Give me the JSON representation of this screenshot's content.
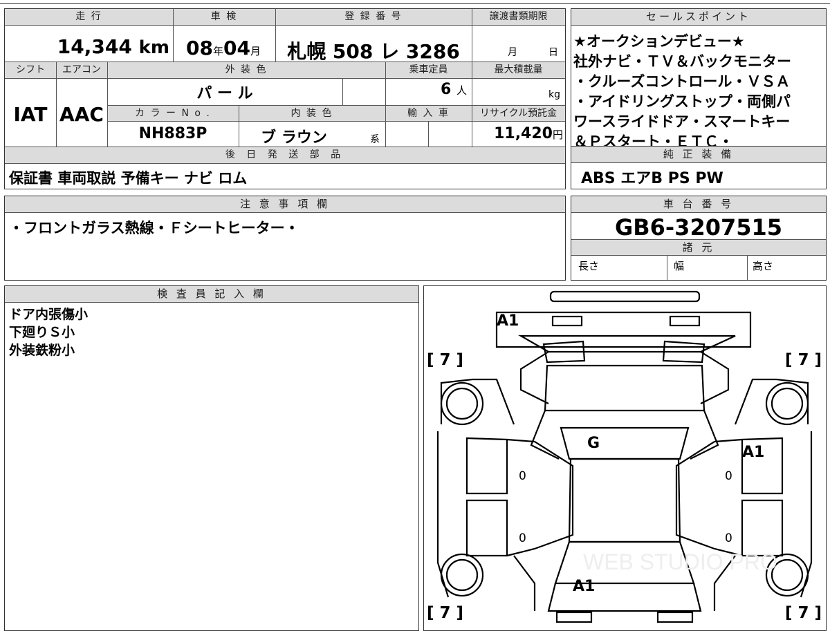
{
  "top_row": {
    "hdr_mileage": "走 行",
    "mileage_value": "14,344",
    "mileage_unit": "km",
    "hdr_inspection": "車 検",
    "inspection_year": "08",
    "year_unit": "年",
    "inspection_month": "04",
    "month_unit": "月",
    "hdr_registration": "登 録 番 号",
    "registration_value": "札幌 508 レ 3286",
    "hdr_transfer_deadline": "譲渡書類期限",
    "transfer_month_unit": "月",
    "transfer_day_unit": "日"
  },
  "mid_row": {
    "hdr_shift": "シフト",
    "shift_value": "IAT",
    "hdr_aircon": "エアコン",
    "aircon_value": "AAC",
    "hdr_exterior_color": "外 装 色",
    "exterior_color_value": "パ ー ル",
    "hdr_capacity": "乗車定員",
    "capacity_value": "6",
    "capacity_unit": "人",
    "hdr_max_load": "最大積載量",
    "max_load_unit": "kg",
    "hdr_color_no": "カ ラ ー N o .",
    "color_no_value": "NH883P",
    "hdr_interior_color": "内 装 色",
    "interior_color_value": "ブ ラウン",
    "interior_color_suffix": "系",
    "hdr_import": "輸 入 車",
    "hdr_recycle": "リサイクル預託金",
    "recycle_value": "11,420",
    "recycle_unit": "円"
  },
  "later_parts": {
    "header": "後 日 発 送 部 品",
    "value": "保証書 車両取説 予備キー ナビ ロム"
  },
  "sales_points": {
    "header": "セールスポイント",
    "lines": [
      "★オークションデビュー★",
      "社外ナビ・ＴＶ＆バックモニター",
      "・クルーズコントロール・ＶＳＡ",
      "・アイドリングストップ・両側パ",
      "ワースライドドア・スマートキー",
      "＆Ｐスタート・ＥＴＣ・"
    ]
  },
  "equipment": {
    "header": "純 正 装 備",
    "value": "ABS エアB PS PW"
  },
  "caution": {
    "header": "注 意 事 項 欄",
    "value": "・フロントガラス熱線・Ｆシートヒーター・"
  },
  "chassis": {
    "header": "車 台 番 号",
    "value": "GB6-3207515",
    "spec_header": "諸 元",
    "length_label": "長さ",
    "width_label": "幅",
    "height_label": "高さ"
  },
  "inspector": {
    "header": "検 査 員 記 入 欄",
    "lines": [
      "ドア内張傷小",
      "下廻りＳ小",
      "外装鉄粉小"
    ]
  },
  "diagram": {
    "label_front_bumper": "A1",
    "label_windshield": "G",
    "label_right_front": "A1",
    "label_rear": "A1",
    "zero": "0",
    "tire_tl": "[ 7 ]",
    "tire_tr": "[ 7 ]",
    "tire_bl": "[ 7 ]",
    "tire_br": "[ 7 ]",
    "watermark": "WEB STUDIO PRO"
  }
}
